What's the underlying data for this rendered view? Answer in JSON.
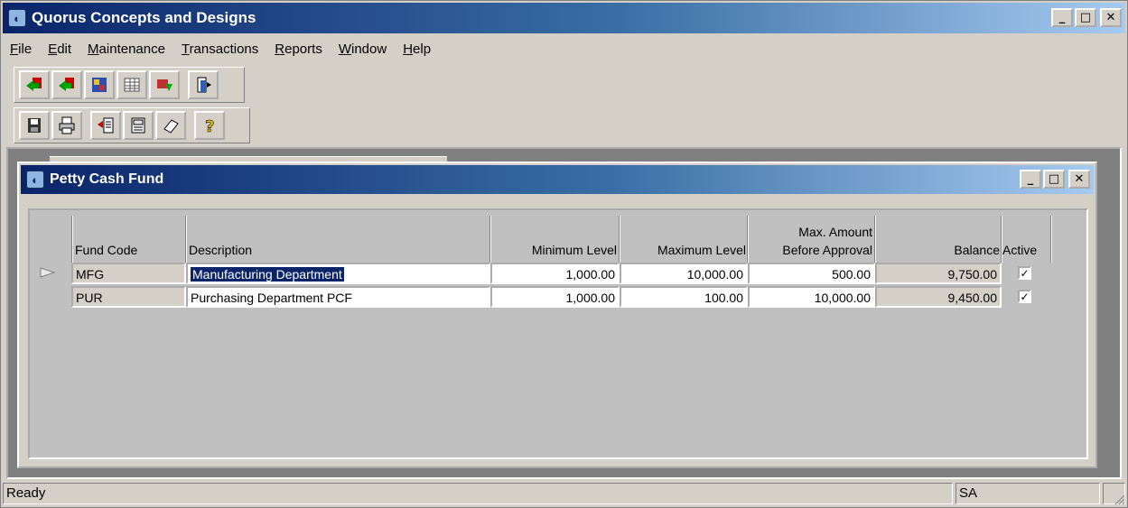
{
  "app": {
    "title": "Quorus Concepts and Designs",
    "controls": {
      "minimize": "_",
      "maximize": "□",
      "close": "✕"
    }
  },
  "menu": [
    {
      "pre": "",
      "u": "F",
      "post": "ile"
    },
    {
      "pre": "",
      "u": "E",
      "post": "dit"
    },
    {
      "pre": "",
      "u": "M",
      "post": "aintenance"
    },
    {
      "pre": "",
      "u": "T",
      "post": "ransactions"
    },
    {
      "pre": "",
      "u": "R",
      "post": "eports"
    },
    {
      "pre": "",
      "u": "W",
      "post": "indow"
    },
    {
      "pre": "",
      "u": "H",
      "post": "elp"
    }
  ],
  "toolbar1": [
    "arrow-back-icon",
    "arrow-back-alt-icon",
    "image-icon",
    "grid-icon",
    "transfer-icon",
    "exit-door-icon"
  ],
  "toolbar2": [
    "save-icon",
    "print-icon",
    "add-record-icon",
    "notes-icon",
    "eraser-icon",
    "help-icon"
  ],
  "child": {
    "title": "Petty Cash Fund",
    "columns": {
      "fund_code": "Fund Code",
      "description": "Description",
      "minimum_level": "Minimum Level",
      "maximum_level": "Maximum Level",
      "max_amount_line1": "Max. Amount",
      "max_amount_line2": "Before Approval",
      "balance": "Balance",
      "active": "Active"
    },
    "rows": [
      {
        "fund_code": "MFG",
        "description": "Manufacturing Department",
        "minimum_level": "1,000.00",
        "maximum_level": "10,000.00",
        "max_amount": "500.00",
        "balance": "9,750.00",
        "active": "✓"
      },
      {
        "fund_code": "PUR",
        "description": "Purchasing Department PCF",
        "minimum_level": "1,000.00",
        "maximum_level": "100.00",
        "max_amount": "10,000.00",
        "balance": "9,450.00",
        "active": "✓"
      }
    ]
  },
  "status": {
    "message": "Ready",
    "user": "SA"
  },
  "colors": {
    "titlebar_start": "#0a246a",
    "titlebar_end": "#a6caf0",
    "face": "#d4d0c8",
    "selection": "#0a246a"
  }
}
